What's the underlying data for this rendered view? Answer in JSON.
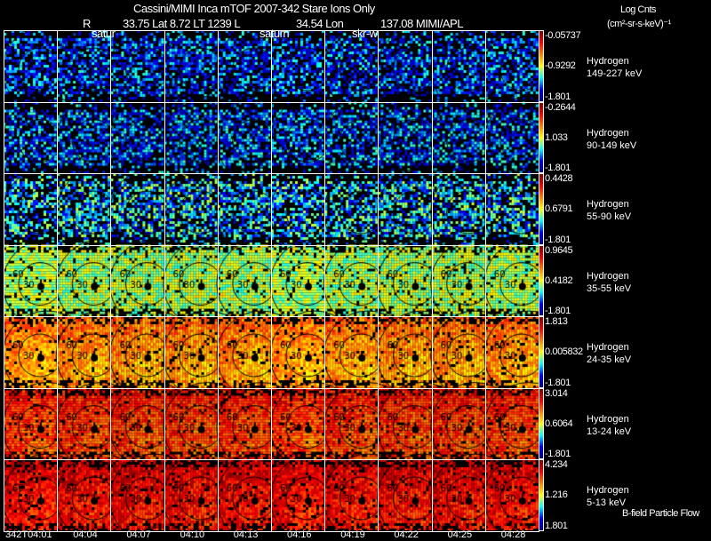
{
  "header": {
    "title": "Cassini/MIMI Inca mTOF  2007-342   Stare   Ions Only",
    "subtitle_r": "R",
    "subtitle_pos": "33.75 Lat 8.72 LT 1239 L",
    "subtitle_lon": "34.54 Lon",
    "subtitle_src": "137.08  MIMI/APL",
    "units_line1": "Log Cnts",
    "units_line2": "(cm²-sr-s-keV)⁻¹",
    "overlay_labels": [
      "satur",
      "saturn",
      "skr-w"
    ]
  },
  "footer": {
    "note": "B-field Particle Flow"
  },
  "chart_data": {
    "type": "heatmap",
    "time_labels": [
      "342T04:01",
      "04:04",
      "04:07",
      "04:10",
      "04:13",
      "04:16",
      "04:19",
      "04:22",
      "04:25",
      "04:28"
    ],
    "contour_labels": [
      "60",
      "30"
    ],
    "colormap": [
      "#00008f",
      "#0000ff",
      "#00ffff",
      "#ffff00",
      "#ff7f00",
      "#ff0000",
      "#800000"
    ],
    "rows": [
      {
        "species": "Hydrogen",
        "energy": "149-227 keV",
        "cb_max": "-0.05737",
        "cb_mid": "-0.9292",
        "cb_min": "-1.801",
        "level": 0.2
      },
      {
        "species": "Hydrogen",
        "energy": "90-149 keV",
        "cb_max": "-0.2644",
        "cb_mid": "1.033",
        "cb_min": "-1.801",
        "level": 0.22
      },
      {
        "species": "Hydrogen",
        "energy": "55-90 keV",
        "cb_max": "0.4428",
        "cb_mid": "0.6791",
        "cb_min": "-1.801",
        "level": 0.3
      },
      {
        "species": "Hydrogen",
        "energy": "35-55 keV",
        "cb_max": "0.9645",
        "cb_mid": "0.4182",
        "cb_min": "-1.801",
        "level": 0.45
      },
      {
        "species": "Hydrogen",
        "energy": "24-35 keV",
        "cb_max": "1.813",
        "cb_mid": "0.005832",
        "cb_min": "-1.801",
        "level": 0.58
      },
      {
        "species": "Hydrogen",
        "energy": "13-24 keV",
        "cb_max": "3.014",
        "cb_mid": "0.6064",
        "cb_min": "-1.801",
        "level": 0.7
      },
      {
        "species": "Hydrogen",
        "energy": "5-13 keV",
        "cb_max": "4.234",
        "cb_mid": "1.216",
        "cb_min": "1.801",
        "level": 0.78
      }
    ]
  }
}
